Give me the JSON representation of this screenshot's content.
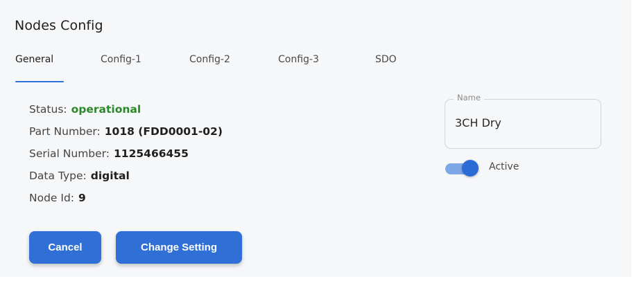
{
  "dialog": {
    "title": "Nodes Config"
  },
  "tabs": [
    {
      "label": "General",
      "active": true
    },
    {
      "label": "Config-1",
      "active": false
    },
    {
      "label": "Config-2",
      "active": false
    },
    {
      "label": "Config-3",
      "active": false
    },
    {
      "label": "SDO",
      "active": false
    }
  ],
  "info": {
    "status_label": "Status:",
    "status_value": "operational",
    "part_number_label": "Part Number:",
    "part_number_value": "1018 (FDD0001-02)",
    "serial_number_label": "Serial Number:",
    "serial_number_value": "1125466455",
    "data_type_label": "Data Type:",
    "data_type_value": "digital",
    "node_id_label": "Node Id:",
    "node_id_value": "9"
  },
  "name_field": {
    "legend": "Name",
    "value": "3CH Dry"
  },
  "active_toggle": {
    "label": "Active",
    "checked": true
  },
  "buttons": {
    "cancel_label": "Cancel",
    "change_label": "Change Setting"
  },
  "colors": {
    "accent": "#2f6fd6",
    "status_ok": "#2a8a2a"
  }
}
